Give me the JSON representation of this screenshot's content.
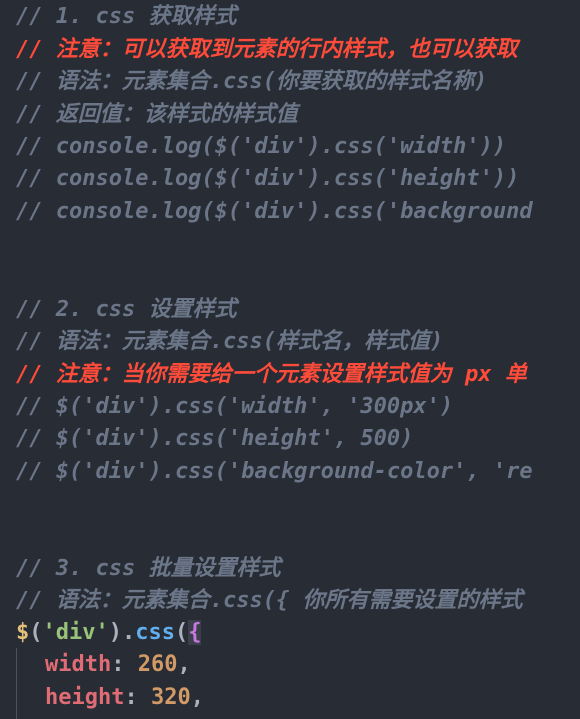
{
  "code_lines": [
    "// 1. css 获取样式",
    "// 注意：可以获取到元素的行内样式，也可以获取",
    "// 语法：元素集合.css(你要获取的样式名称)",
    "// 返回值：该样式的样式值",
    "// console.log($('div').css('width'))",
    "// console.log($('div').css('height'))",
    "// console.log($('div').css('background",
    "// 2. css 设置样式",
    "// 语法：元素集合.css(样式名，样式值)",
    "// 注意：当你需要给一个元素设置样式值为 px 单",
    "// $('div').css('width', '300px')",
    "// $('div').css('height', 500)",
    "// $('div').css('background-color', 're",
    "// 3. css 批量设置样式",
    "// 语法：元素集合.css({ 你所有需要设置的样式"
  ],
  "code": {
    "l16": {
      "dollar": "$",
      "p1": "(",
      "str": "'div'",
      "p2": ")",
      "dot": ".",
      "method": "css",
      "p3": "(",
      "brace": "{"
    },
    "l17": {
      "prop": "width",
      "colon": ": ",
      "value": "260",
      "comma": ","
    },
    "l18": {
      "prop": "height",
      "colon": ": ",
      "value": "320",
      "comma": ","
    }
  }
}
